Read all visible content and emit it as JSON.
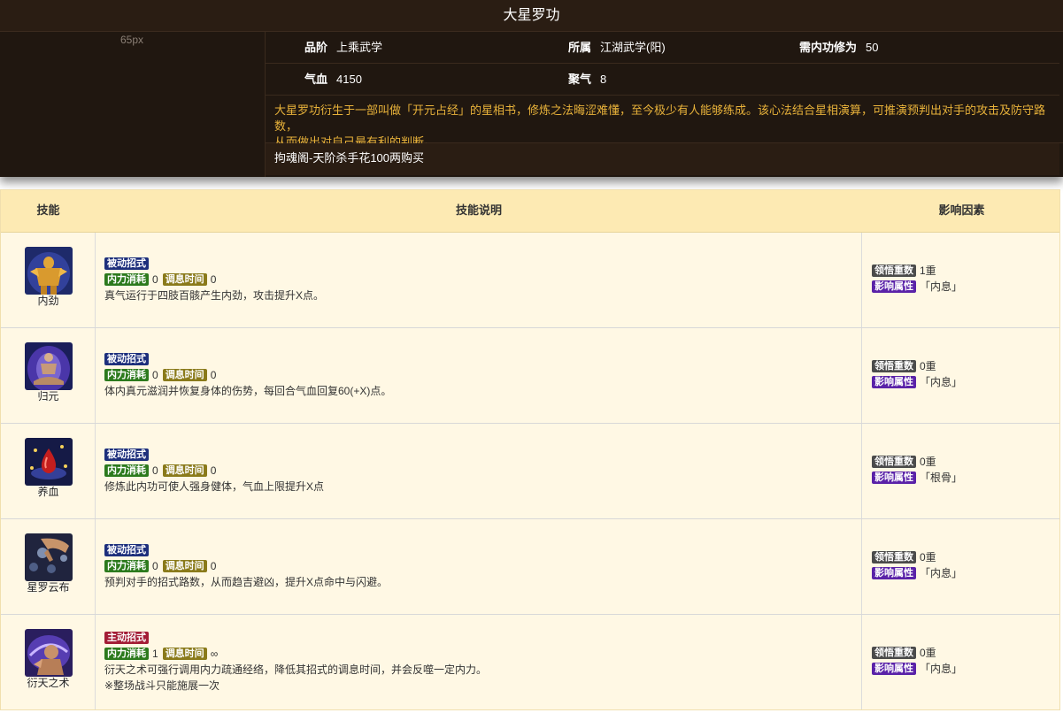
{
  "title": "大星罗功",
  "image_placeholder": "65px",
  "info": {
    "grade_label": "品阶",
    "grade_value": "上乘武学",
    "belong_label": "所属",
    "belong_value": "江湖武学(阳)",
    "req_label": "需内功修为",
    "req_value": "50",
    "hp_label": "气血",
    "hp_value": "4150",
    "qi_label": "聚气",
    "qi_value": "8"
  },
  "description_line1": "大星罗功衍生于一部叫做「开元占经」的星相书，修炼之法晦涩难懂，至今极少有人能够练成。该心法结合星相演算，可推演预判出对手的攻击及防守路数，",
  "description_line2": "从而做出对自己最有利的判断。",
  "source": "拘魂阁-天阶杀手花100两购买",
  "table": {
    "headers": [
      "技能",
      "技能说明",
      "影响因素"
    ],
    "rows": [
      {
        "name": "内劲",
        "icon": "golden-fighter-icon",
        "type_tag": "被动招式",
        "type_color": "blue",
        "cost_label": "内力消耗",
        "cost": "0",
        "cooldown_label": "调息时间",
        "cooldown": "0",
        "desc": "真气运行于四肢百骸产生内劲，攻击提升X点。",
        "note": "",
        "level_label": "领悟重数",
        "level": "1重",
        "attr_label": "影响属性",
        "attr": "「内息」"
      },
      {
        "name": "归元",
        "icon": "meditating-monk-icon",
        "type_tag": "被动招式",
        "type_color": "blue",
        "cost_label": "内力消耗",
        "cost": "0",
        "cooldown_label": "调息时间",
        "cooldown": "0",
        "desc": "体内真元滋润并恢复身体的伤势，每回合气血回复60(+X)点。",
        "note": "",
        "level_label": "领悟重数",
        "level": "0重",
        "attr_label": "影响属性",
        "attr": "「内息」"
      },
      {
        "name": "养血",
        "icon": "blood-drop-icon",
        "type_tag": "被动招式",
        "type_color": "blue",
        "cost_label": "内力消耗",
        "cost": "0",
        "cooldown_label": "调息时间",
        "cooldown": "0",
        "desc": "修炼此内功可使人强身健体，气血上限提升X点",
        "note": "",
        "level_label": "领悟重数",
        "level": "0重",
        "attr_label": "影响属性",
        "attr": "「根骨」"
      },
      {
        "name": "星罗云布",
        "icon": "star-hand-icon",
        "type_tag": "被动招式",
        "type_color": "blue",
        "cost_label": "内力消耗",
        "cost": "0",
        "cooldown_label": "调息时间",
        "cooldown": "0",
        "desc": "预判对手的招式路数，从而趋吉避凶，提升X点命中与闪避。",
        "note": "",
        "level_label": "领悟重数",
        "level": "0重",
        "attr_label": "影响属性",
        "attr": "「内息」"
      },
      {
        "name": "衍天之术",
        "icon": "divination-icon",
        "type_tag": "主动招式",
        "type_color": "red",
        "cost_label": "内力消耗",
        "cost": "1",
        "cooldown_label": "调息时间",
        "cooldown": "∞",
        "desc": "衍天之术可强行调用内力疏通经络，降低其招式的调息时间，并会反噬一定内力。",
        "note": "※整场战斗只能施展一次",
        "level_label": "领悟重数",
        "level": "0重",
        "attr_label": "影响属性",
        "attr": "「内息」"
      }
    ]
  }
}
